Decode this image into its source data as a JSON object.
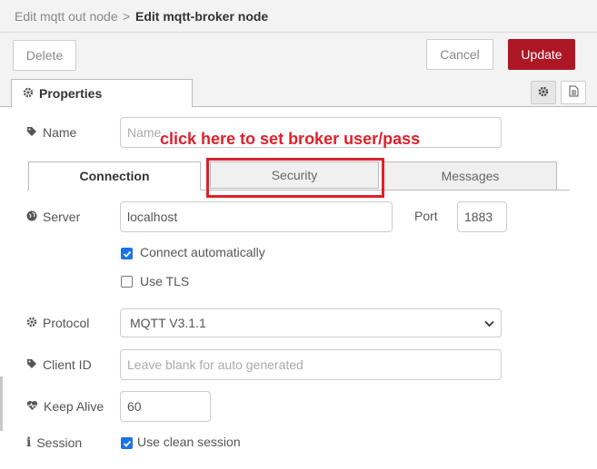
{
  "breadcrumb": {
    "parent": "Edit mqtt out node",
    "separator": ">",
    "current": "Edit mqtt-broker node"
  },
  "toolbar": {
    "delete_label": "Delete",
    "cancel_label": "Cancel",
    "update_label": "Update"
  },
  "tabs": {
    "properties_label": "Properties"
  },
  "form": {
    "name": {
      "label": "Name",
      "placeholder": "Name"
    },
    "annotation": "click here to set broker user/pass",
    "connection_tabs": [
      "Connection",
      "Security",
      "Messages"
    ],
    "server": {
      "label": "Server",
      "value": "localhost"
    },
    "port": {
      "label": "Port",
      "value": "1883"
    },
    "connect_auto": {
      "label": "Connect automatically",
      "checked": true
    },
    "use_tls": {
      "label": "Use TLS",
      "checked": false
    },
    "protocol": {
      "label": "Protocol",
      "value": "MQTT V3.1.1"
    },
    "client_id": {
      "label": "Client ID",
      "placeholder": "Leave blank for auto generated"
    },
    "keep_alive": {
      "label": "Keep Alive",
      "value": "60"
    },
    "session": {
      "label": "Session",
      "checkbox_label": "Use clean session",
      "checked": true
    }
  },
  "colors": {
    "update_button": "#ad1625",
    "annotation": "#e0202a",
    "checkbox_checked": "#1a73e8"
  },
  "icons": [
    "gear-icon",
    "document-icon",
    "tag-icon",
    "globe-icon",
    "heartbeat-icon",
    "info-icon",
    "chevron-down-icon"
  ]
}
